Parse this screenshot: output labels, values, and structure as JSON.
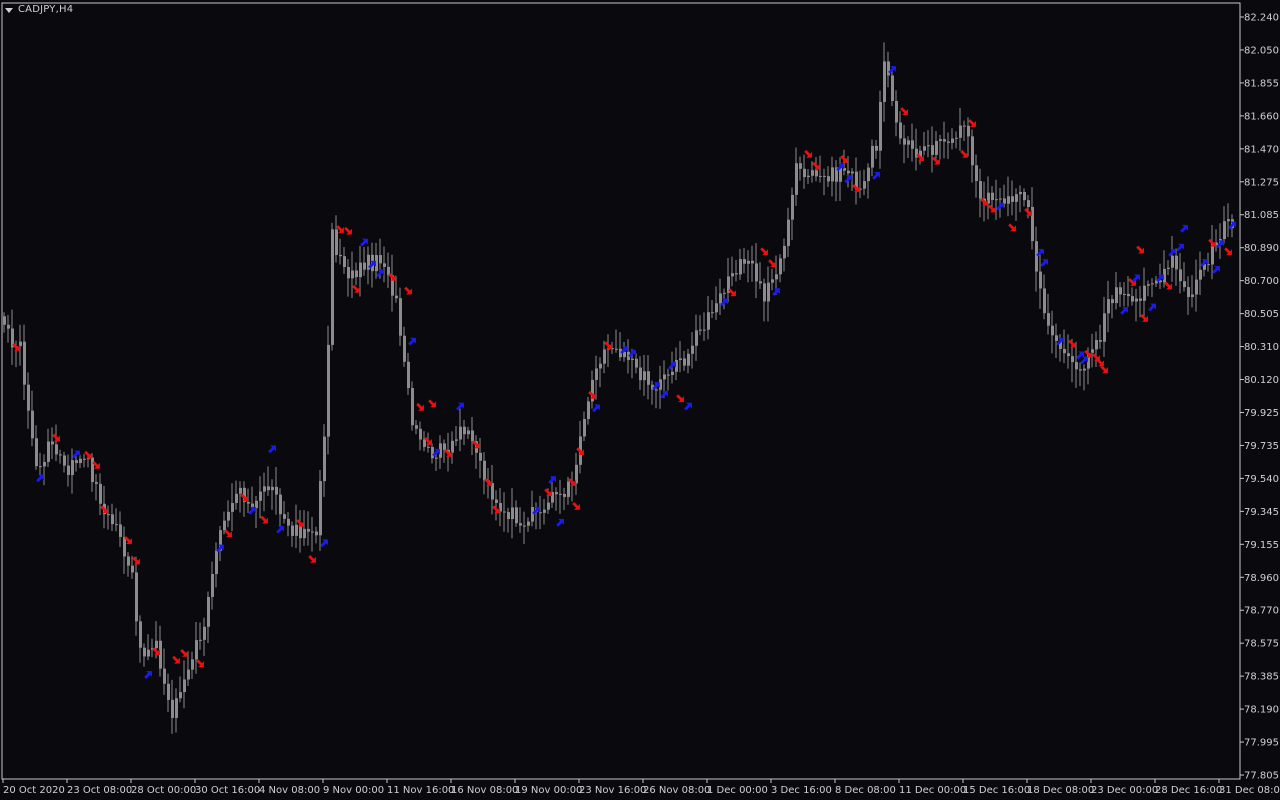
{
  "window": {
    "symbol": "CADJPY,H4",
    "icon": "triangle-down-icon"
  },
  "colors": {
    "background": "#0a0a0e",
    "candle": "#8c8c8c",
    "axis": "#c8c8c8",
    "buy_arrow": "#1b1bf0",
    "sell_arrow": "#e81010"
  },
  "chart_data": {
    "type": "candlestick",
    "ylim": [
      77.805,
      82.24
    ],
    "y_ticks": [
      "82.240",
      "82.050",
      "81.855",
      "81.660",
      "81.470",
      "81.275",
      "81.085",
      "80.890",
      "80.700",
      "80.505",
      "80.310",
      "80.120",
      "79.925",
      "79.735",
      "79.540",
      "79.345",
      "79.155",
      "78.960",
      "78.770",
      "78.575",
      "78.385",
      "78.190",
      "77.995",
      "77.805"
    ],
    "x_ticks": [
      "20 Oct 2020",
      "23 Oct 08:00",
      "28 Oct 00:00",
      "30 Oct 16:00",
      "4 Nov 08:00",
      "9 Nov 00:00",
      "11 Nov 16:00",
      "16 Nov 08:00",
      "19 Nov 00:00",
      "23 Nov 16:00",
      "26 Nov 08:00",
      "1 Dec 00:00",
      "3 Dec 16:00",
      "8 Dec 08:00",
      "11 Dec 00:00",
      "15 Dec 16:00",
      "18 Dec 08:00",
      "23 Dec 00:00",
      "28 Dec 16:00",
      "31 Dec 08:00"
    ],
    "anchors": [
      [
        0,
        80.4
      ],
      [
        4,
        80.3
      ],
      [
        8,
        79.6
      ],
      [
        12,
        79.75
      ],
      [
        16,
        79.6
      ],
      [
        20,
        79.7
      ],
      [
        24,
        79.4
      ],
      [
        28,
        79.25
      ],
      [
        32,
        79.0
      ],
      [
        34,
        78.5
      ],
      [
        38,
        78.55
      ],
      [
        42,
        78.15
      ],
      [
        46,
        78.45
      ],
      [
        50,
        78.7
      ],
      [
        54,
        79.2
      ],
      [
        58,
        79.45
      ],
      [
        62,
        79.4
      ],
      [
        66,
        79.5
      ],
      [
        70,
        79.3
      ],
      [
        74,
        79.2
      ],
      [
        78,
        79.25
      ],
      [
        80,
        79.75
      ],
      [
        82,
        80.95
      ],
      [
        86,
        80.7
      ],
      [
        90,
        80.8
      ],
      [
        94,
        80.8
      ],
      [
        98,
        80.6
      ],
      [
        102,
        79.9
      ],
      [
        106,
        79.7
      ],
      [
        110,
        79.7
      ],
      [
        114,
        79.85
      ],
      [
        118,
        79.7
      ],
      [
        122,
        79.4
      ],
      [
        126,
        79.35
      ],
      [
        130,
        79.3
      ],
      [
        134,
        79.35
      ],
      [
        138,
        79.45
      ],
      [
        142,
        79.5
      ],
      [
        146,
        80.0
      ],
      [
        150,
        80.3
      ],
      [
        154,
        80.25
      ],
      [
        158,
        80.2
      ],
      [
        162,
        80.05
      ],
      [
        166,
        80.15
      ],
      [
        170,
        80.25
      ],
      [
        174,
        80.4
      ],
      [
        178,
        80.6
      ],
      [
        182,
        80.7
      ],
      [
        186,
        80.85
      ],
      [
        190,
        80.6
      ],
      [
        194,
        80.8
      ],
      [
        198,
        81.35
      ],
      [
        202,
        81.35
      ],
      [
        206,
        81.3
      ],
      [
        210,
        81.35
      ],
      [
        214,
        81.25
      ],
      [
        218,
        81.5
      ],
      [
        220,
        81.95
      ],
      [
        224,
        81.55
      ],
      [
        228,
        81.45
      ],
      [
        232,
        81.45
      ],
      [
        236,
        81.55
      ],
      [
        240,
        81.6
      ],
      [
        244,
        81.2
      ],
      [
        248,
        81.15
      ],
      [
        252,
        81.2
      ],
      [
        256,
        81.15
      ],
      [
        258,
        80.75
      ],
      [
        262,
        80.35
      ],
      [
        266,
        80.25
      ],
      [
        270,
        80.2
      ],
      [
        274,
        80.35
      ],
      [
        276,
        80.6
      ],
      [
        280,
        80.65
      ],
      [
        284,
        80.6
      ],
      [
        288,
        80.7
      ],
      [
        292,
        80.85
      ],
      [
        296,
        80.6
      ],
      [
        300,
        80.8
      ],
      [
        304,
        80.95
      ],
      [
        306,
        81.05
      ]
    ],
    "arrows": [
      {
        "i": 3,
        "dir": "down",
        "price": 80.31
      },
      {
        "i": 9,
        "dir": "up",
        "price": 79.54
      },
      {
        "i": 13,
        "dir": "down",
        "price": 79.78
      },
      {
        "i": 18,
        "dir": "up",
        "price": 79.68
      },
      {
        "i": 21,
        "dir": "down",
        "price": 79.68
      },
      {
        "i": 23,
        "dir": "down",
        "price": 79.62
      },
      {
        "i": 25,
        "dir": "down",
        "price": 79.36
      },
      {
        "i": 31,
        "dir": "down",
        "price": 79.18
      },
      {
        "i": 33,
        "dir": "down",
        "price": 79.06
      },
      {
        "i": 36,
        "dir": "up",
        "price": 78.39
      },
      {
        "i": 38,
        "dir": "down",
        "price": 78.53
      },
      {
        "i": 43,
        "dir": "down",
        "price": 78.48
      },
      {
        "i": 45,
        "dir": "down",
        "price": 78.52
      },
      {
        "i": 49,
        "dir": "down",
        "price": 78.46
      },
      {
        "i": 54,
        "dir": "up",
        "price": 79.13
      },
      {
        "i": 56,
        "dir": "down",
        "price": 79.22
      },
      {
        "i": 60,
        "dir": "down",
        "price": 79.43
      },
      {
        "i": 62,
        "dir": "up",
        "price": 79.35
      },
      {
        "i": 65,
        "dir": "down",
        "price": 79.3
      },
      {
        "i": 67,
        "dir": "up",
        "price": 79.71
      },
      {
        "i": 69,
        "dir": "up",
        "price": 79.24
      },
      {
        "i": 74,
        "dir": "down",
        "price": 79.28
      },
      {
        "i": 77,
        "dir": "down",
        "price": 79.07
      },
      {
        "i": 80,
        "dir": "up",
        "price": 79.16
      },
      {
        "i": 84,
        "dir": "down",
        "price": 81.0
      },
      {
        "i": 86,
        "dir": "down",
        "price": 80.99
      },
      {
        "i": 88,
        "dir": "down",
        "price": 80.65
      },
      {
        "i": 90,
        "dir": "up",
        "price": 80.92
      },
      {
        "i": 92,
        "dir": "up",
        "price": 80.79
      },
      {
        "i": 94,
        "dir": "up",
        "price": 80.74
      },
      {
        "i": 97,
        "dir": "down",
        "price": 80.72
      },
      {
        "i": 101,
        "dir": "down",
        "price": 80.64
      },
      {
        "i": 102,
        "dir": "up",
        "price": 80.34
      },
      {
        "i": 104,
        "dir": "down",
        "price": 79.96
      },
      {
        "i": 107,
        "dir": "down",
        "price": 79.98
      },
      {
        "i": 106,
        "dir": "down",
        "price": 79.76
      },
      {
        "i": 108,
        "dir": "up",
        "price": 79.69
      },
      {
        "i": 111,
        "dir": "down",
        "price": 79.69
      },
      {
        "i": 114,
        "dir": "up",
        "price": 79.96
      },
      {
        "i": 118,
        "dir": "down",
        "price": 79.74
      },
      {
        "i": 121,
        "dir": "down",
        "price": 79.52
      },
      {
        "i": 123,
        "dir": "down",
        "price": 79.36
      },
      {
        "i": 133,
        "dir": "up",
        "price": 79.35
      },
      {
        "i": 136,
        "dir": "down",
        "price": 79.46
      },
      {
        "i": 137,
        "dir": "up",
        "price": 79.53
      },
      {
        "i": 139,
        "dir": "up",
        "price": 79.28
      },
      {
        "i": 142,
        "dir": "down",
        "price": 79.52
      },
      {
        "i": 143,
        "dir": "down",
        "price": 79.38
      },
      {
        "i": 144,
        "dir": "down",
        "price": 79.7
      },
      {
        "i": 147,
        "dir": "down",
        "price": 80.03
      },
      {
        "i": 148,
        "dir": "up",
        "price": 79.95
      },
      {
        "i": 151,
        "dir": "down",
        "price": 80.32
      },
      {
        "i": 155,
        "dir": "up",
        "price": 80.29
      },
      {
        "i": 157,
        "dir": "up",
        "price": 80.27
      },
      {
        "i": 163,
        "dir": "up",
        "price": 80.08
      },
      {
        "i": 165,
        "dir": "up",
        "price": 80.03
      },
      {
        "i": 167,
        "dir": "up",
        "price": 80.2
      },
      {
        "i": 169,
        "dir": "down",
        "price": 80.01
      },
      {
        "i": 171,
        "dir": "up",
        "price": 79.96
      },
      {
        "i": 180,
        "dir": "up",
        "price": 80.57
      },
      {
        "i": 182,
        "dir": "down",
        "price": 80.63
      },
      {
        "i": 190,
        "dir": "down",
        "price": 80.87
      },
      {
        "i": 192,
        "dir": "down",
        "price": 80.8
      },
      {
        "i": 193,
        "dir": "up",
        "price": 80.63
      },
      {
        "i": 201,
        "dir": "down",
        "price": 81.44
      },
      {
        "i": 203,
        "dir": "down",
        "price": 81.37
      },
      {
        "i": 209,
        "dir": "up",
        "price": 81.36
      },
      {
        "i": 211,
        "dir": "up",
        "price": 81.29
      },
      {
        "i": 213,
        "dir": "down",
        "price": 81.24
      },
      {
        "i": 210,
        "dir": "down",
        "price": 81.41
      },
      {
        "i": 218,
        "dir": "up",
        "price": 81.31
      },
      {
        "i": 222,
        "dir": "up",
        "price": 81.93
      },
      {
        "i": 225,
        "dir": "down",
        "price": 81.69
      },
      {
        "i": 229,
        "dir": "down",
        "price": 81.42
      },
      {
        "i": 233,
        "dir": "down",
        "price": 81.4
      },
      {
        "i": 240,
        "dir": "down",
        "price": 81.44
      },
      {
        "i": 242,
        "dir": "down",
        "price": 81.62
      },
      {
        "i": 245,
        "dir": "down",
        "price": 81.16
      },
      {
        "i": 247,
        "dir": "down",
        "price": 81.12
      },
      {
        "i": 249,
        "dir": "up",
        "price": 81.13
      },
      {
        "i": 252,
        "dir": "down",
        "price": 81.01
      },
      {
        "i": 256,
        "dir": "down",
        "price": 81.1
      },
      {
        "i": 259,
        "dir": "up",
        "price": 80.86
      },
      {
        "i": 260,
        "dir": "up",
        "price": 80.8
      },
      {
        "i": 264,
        "dir": "up",
        "price": 80.34
      },
      {
        "i": 267,
        "dir": "down",
        "price": 80.33
      },
      {
        "i": 269,
        "dir": "up",
        "price": 80.26
      },
      {
        "i": 270,
        "dir": "up",
        "price": 80.23
      },
      {
        "i": 271,
        "dir": "down",
        "price": 80.27
      },
      {
        "i": 273,
        "dir": "down",
        "price": 80.25
      },
      {
        "i": 274,
        "dir": "down",
        "price": 80.22
      },
      {
        "i": 275,
        "dir": "down",
        "price": 80.18
      },
      {
        "i": 280,
        "dir": "up",
        "price": 80.52
      },
      {
        "i": 282,
        "dir": "down",
        "price": 80.69
      },
      {
        "i": 283,
        "dir": "up",
        "price": 80.71
      },
      {
        "i": 284,
        "dir": "down",
        "price": 80.88
      },
      {
        "i": 285,
        "dir": "down",
        "price": 80.48
      },
      {
        "i": 287,
        "dir": "up",
        "price": 80.54
      },
      {
        "i": 289,
        "dir": "up",
        "price": 80.71
      },
      {
        "i": 291,
        "dir": "down",
        "price": 80.67
      },
      {
        "i": 292,
        "dir": "up",
        "price": 80.86
      },
      {
        "i": 294,
        "dir": "up",
        "price": 80.89
      },
      {
        "i": 295,
        "dir": "up",
        "price": 81.0
      },
      {
        "i": 300,
        "dir": "up",
        "price": 80.8
      },
      {
        "i": 302,
        "dir": "down",
        "price": 80.92
      },
      {
        "i": 303,
        "dir": "up",
        "price": 80.76
      },
      {
        "i": 304,
        "dir": "up",
        "price": 80.91
      },
      {
        "i": 306,
        "dir": "down",
        "price": 80.87
      },
      {
        "i": 307,
        "dir": "up",
        "price": 81.02
      }
    ]
  }
}
